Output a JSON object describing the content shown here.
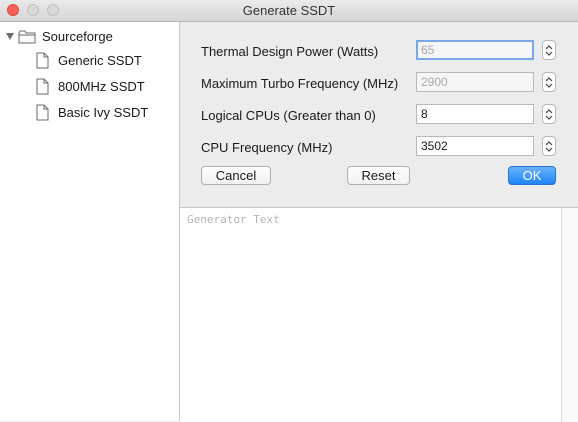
{
  "window": {
    "title": "Generate SSDT"
  },
  "sidebar": {
    "root": {
      "label": "Sourceforge"
    },
    "items": [
      {
        "label": "Generic SSDT"
      },
      {
        "label": "800MHz SSDT"
      },
      {
        "label": "Basic Ivy SSDT"
      }
    ]
  },
  "form": {
    "tdp": {
      "label": "Thermal Design Power (Watts)",
      "value": "65"
    },
    "turbo": {
      "label": "Maximum Turbo Frequency (MHz)",
      "value": "2900"
    },
    "cpus": {
      "label": "Logical CPUs (Greater than 0)",
      "value": "8"
    },
    "freq": {
      "label": "CPU Frequency (MHz)",
      "value": "3502"
    }
  },
  "buttons": {
    "cancel": "Cancel",
    "reset": "Reset",
    "ok": "OK"
  },
  "output": {
    "placeholder": "Generator Text"
  }
}
